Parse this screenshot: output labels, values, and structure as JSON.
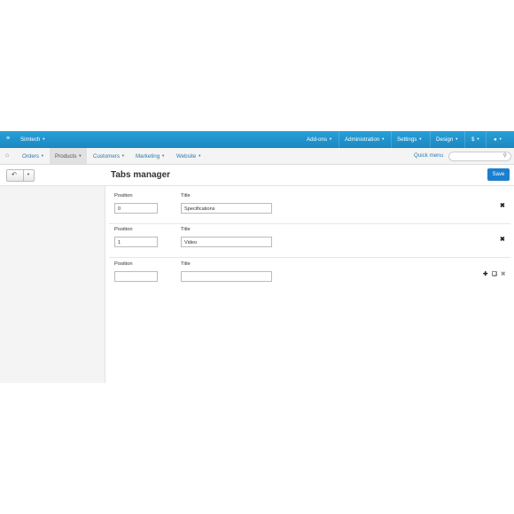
{
  "topbar": {
    "brand": "Simtech",
    "items": [
      {
        "label": "Add-ons"
      },
      {
        "label": "Administration"
      },
      {
        "label": "Settings"
      },
      {
        "label": "Design"
      },
      {
        "label": "$"
      }
    ]
  },
  "navbar": {
    "items": [
      {
        "label": "Orders"
      },
      {
        "label": "Products"
      },
      {
        "label": "Customers"
      },
      {
        "label": "Marketing"
      },
      {
        "label": "Website"
      }
    ],
    "quick_menu": "Quick menu",
    "search_placeholder": ""
  },
  "page": {
    "title": "Tabs manager",
    "save_label": "Save"
  },
  "form": {
    "position_label": "Position",
    "title_label": "Title",
    "rows": [
      {
        "position": "0",
        "title": "Specifications"
      },
      {
        "position": "1",
        "title": "Video"
      },
      {
        "position": "",
        "title": ""
      }
    ]
  },
  "icons": {
    "menu": "menu-icon",
    "home": "home-icon",
    "search": "search-icon",
    "user": "user-icon",
    "back": "back-arrow-icon",
    "delete": "close-icon",
    "add": "plus-icon",
    "clone": "copy-icon"
  }
}
